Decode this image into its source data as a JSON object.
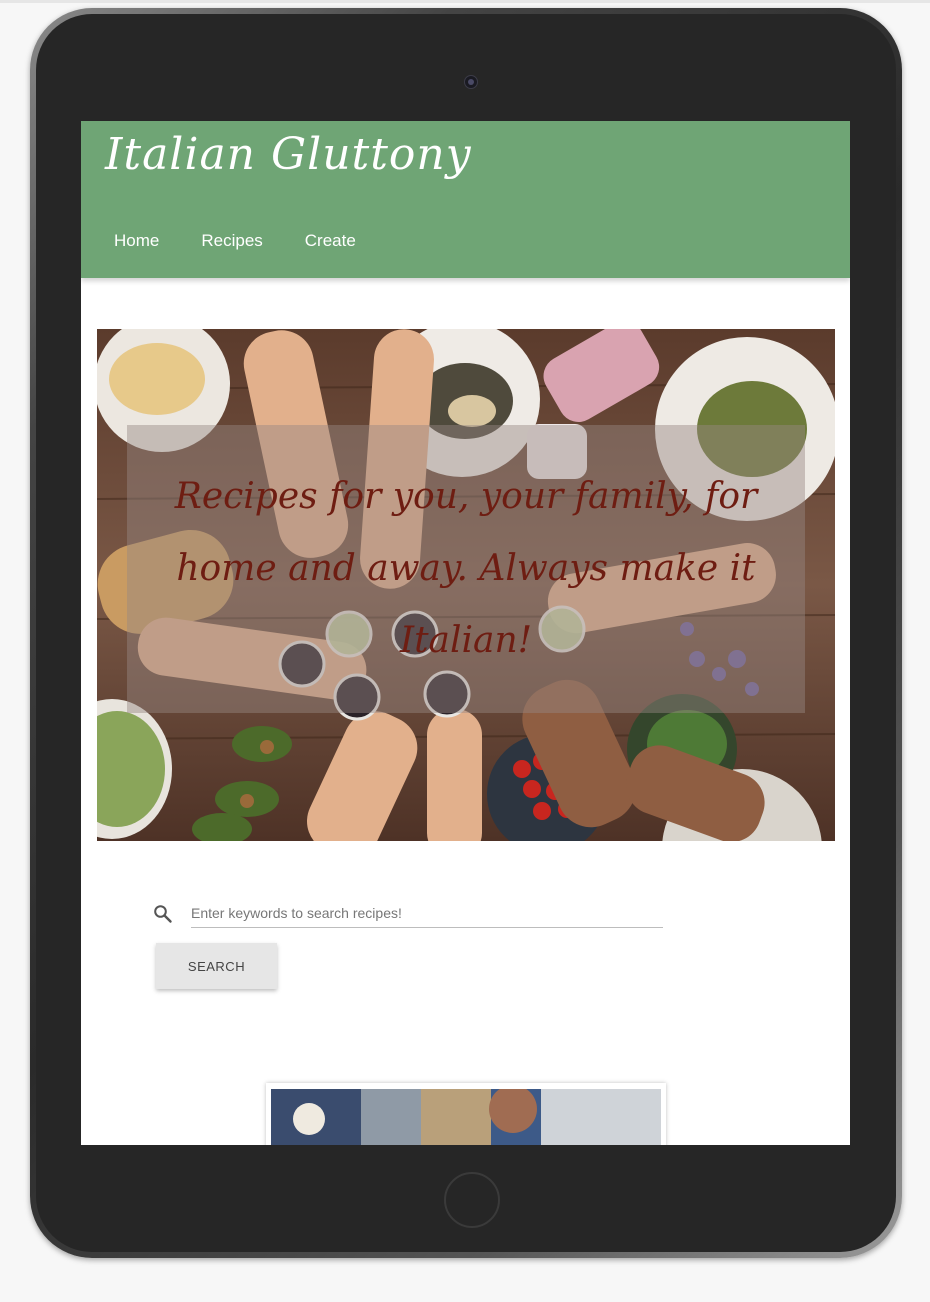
{
  "site": {
    "brand": "Italian Gluttony"
  },
  "nav": {
    "items": [
      {
        "label": "Home"
      },
      {
        "label": "Recipes"
      },
      {
        "label": "Create"
      }
    ]
  },
  "hero": {
    "tagline": "Recipes for you, your family, for home and away. Always make it Italian!"
  },
  "search": {
    "placeholder": "Enter keywords to search recipes!",
    "value": "",
    "button_label": "SEARCH",
    "icon": "search-icon"
  },
  "colors": {
    "header_bg": "#6fa575",
    "tagline": "#6e1d12",
    "button_bg": "#e6e6e6"
  }
}
